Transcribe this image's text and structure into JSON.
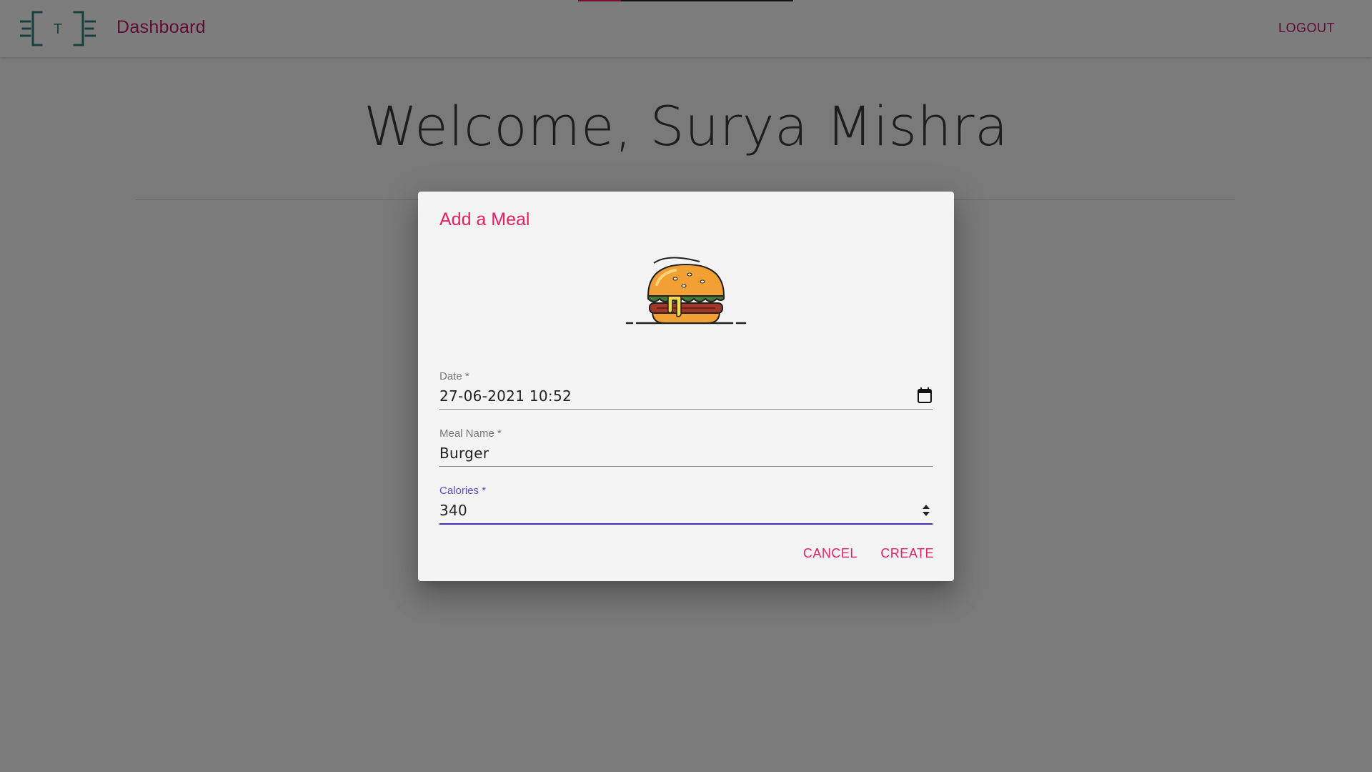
{
  "header": {
    "brand": "Dashboard",
    "logout_label": "LOGOUT",
    "logo_letter": "T",
    "loading_progress_percent": 20
  },
  "main": {
    "welcome_text": "Welcome, Surya Mishra"
  },
  "dialog": {
    "title": "Add a Meal",
    "fields": {
      "date": {
        "label": "Date *",
        "value": "27-06-2021 10:52"
      },
      "meal_name": {
        "label": "Meal Name *",
        "value": "Burger"
      },
      "calories": {
        "label": "Calories *",
        "value": "340"
      }
    },
    "cancel_label": "CANCEL",
    "create_label": "CREATE"
  },
  "icons": [
    "calendar-icon",
    "number-spinner-icon",
    "burger-icon",
    "logo-icon"
  ],
  "colors": {
    "accent": "#e91e63",
    "brand_text": "#c2185b",
    "focus": "#3f2fb0",
    "logo_teal": "#2f7f7a"
  }
}
